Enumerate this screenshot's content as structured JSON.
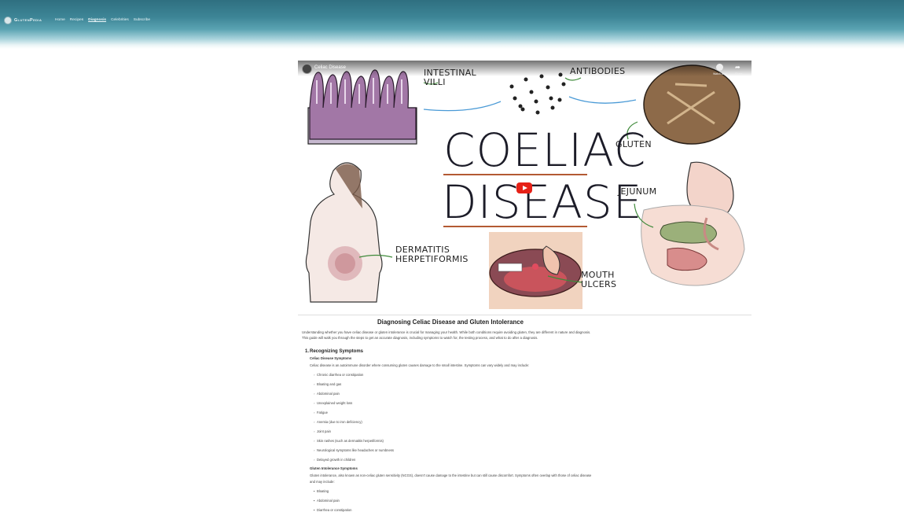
{
  "header": {
    "logo_text": "GlutenPedia",
    "nav": [
      "Home",
      "Recipes",
      "Diagnosis",
      "Celebrities",
      "Subscribe"
    ],
    "active_nav": "Diagnosis"
  },
  "video": {
    "channel_title": "Celiac Disease",
    "watch_later_label": "Watch later",
    "share_label": "Share",
    "labels": {
      "intestinal_villi": "INTESTINAL\nVILLI",
      "antibodies": "ANTIBODIES",
      "gluten": "GLUTEN",
      "title_line1": "COELIAC",
      "title_line2": "DISEASE",
      "jejunum": "JEJUNUM",
      "dermatitis": "DERMATITIS\nHERPETIFORMIS",
      "mouth_ulcers": "MOUTH\nULCERS"
    }
  },
  "article": {
    "title": "Diagnosing Celiac Disease and Gluten Intolerance",
    "intro": "Understanding whether you have celiac disease or gluten intolerance is crucial for managing your health. While both conditions require avoiding gluten, they are different in nature and diagnosis. This guide will walk you through the steps to get an accurate diagnosis, including symptoms to watch for, the testing process, and what to do after a diagnosis.",
    "section1": {
      "number": "1.",
      "title": "Recognizing Symptoms",
      "celiac_heading": "Celiac Disease Symptoms",
      "celiac_text": "Celiac disease is an autoimmune disorder where consuming gluten causes damage to the small intestine. Symptoms can vary widely and may include:",
      "celiac_list": [
        "Chronic diarrhea or constipation",
        "Bloating and gas",
        "Abdominal pain",
        "Unexplained weight loss",
        "Fatigue",
        "Anemia (due to iron deficiency)",
        "Joint pain",
        "Skin rashes (such as dermatitis herpetiformis)",
        "Neurological symptoms like headaches or numbness",
        "Delayed growth in children"
      ],
      "intolerance_heading": "Gluten Intolerance Symptoms",
      "intolerance_text": "Gluten intolerance, also known as non-celiac gluten sensitivity (NCGS), doesn't cause damage to the intestine but can still cause discomfort. Symptoms often overlap with those of celiac disease and may include:",
      "intolerance_list": [
        "Bloating",
        "Abdominal pain",
        "Diarrhea or constipation"
      ]
    }
  }
}
